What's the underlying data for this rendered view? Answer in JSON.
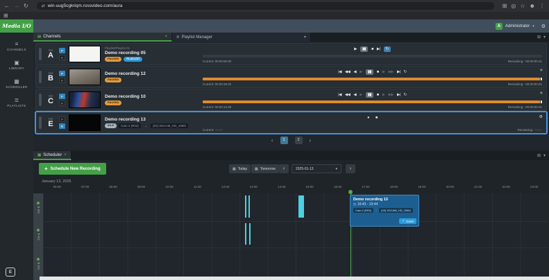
{
  "colors": {
    "brand_green": "#43a047",
    "accent_blue": "#2d9cdb",
    "paused_orange": "#e09a3e",
    "progress_orange": "#e08a2e",
    "selected_blue": "#4a90d9",
    "event_blue": "#1d5e91",
    "marker_cyan": "#4dd0e1",
    "now_green": "#4caf50"
  },
  "icons": {
    "back": "←",
    "forward": "→",
    "reload": "↻",
    "swap": "⇄",
    "extensions": "⊞",
    "search": "◎",
    "star": "☆",
    "avatar": "☻",
    "menu": "⋮",
    "apps": "⊞",
    "caret": "▾",
    "gear": "⚙",
    "grid": "▤",
    "list": "≣",
    "calendar": "▦",
    "close": "×",
    "play": "▶",
    "pause": "▮▮",
    "stop": "■",
    "record": "●",
    "prev": "|◀",
    "next": "▶|",
    "rewind": "◀◀",
    "fastforward": "▶▶",
    "stepback": "◀",
    "stepforward": "▶",
    "loop": "↻",
    "plus": "+",
    "check": "✓",
    "chevron_left": "‹",
    "chevron_right": "›",
    "arrow_right": "→",
    "clock": "◷",
    "panel": "▣",
    "nav_channels": "≡",
    "nav_library": "▣",
    "nav_scheduler": "▦",
    "nav_playlists": "≣",
    "logo_mark": "E"
  },
  "browser": {
    "url": "win-uug5cgkriqm.rossvideo.com/aura"
  },
  "header": {
    "logo": "Media I/O",
    "user": "Administrator",
    "user_initial": "A"
  },
  "sidebar": {
    "items": [
      {
        "label": "CHANNELS"
      },
      {
        "label": "LIBRARY"
      },
      {
        "label": "SCHEDULER"
      },
      {
        "label": "PLAYLISTS"
      }
    ]
  },
  "channels_panel": {
    "tabs": [
      {
        "label": "Channels"
      },
      {
        "label": "Playlist Manager"
      }
    ],
    "pr": [
      "P",
      "R"
    ],
    "rows": [
      {
        "ch": "CH",
        "letter": "A",
        "subtitle": "Playlist/Playlist 01",
        "title": "Demo recording 05",
        "badges": [
          "PAUSED",
          "PLAYLIST"
        ],
        "current": "Current: 00:00:00.00",
        "remaining": "Remaining: -00:00:00.01"
      },
      {
        "ch": "CH",
        "letter": "B",
        "title": "Demo recording 12",
        "badges": [
          "PAUSED"
        ],
        "current": "Current: 00:00:38.02",
        "remaining": "Remaining: -00:00:00.01"
      },
      {
        "ch": "CH",
        "letter": "C",
        "title": "Demo recording 10",
        "badges": [
          "PAUSED"
        ],
        "current": "Current: 00:00:13.06",
        "remaining": "Remaining: -00:00:00.01"
      },
      {
        "ch": "CH",
        "letter": "E",
        "title": "Demo recording 13",
        "badges": [
          "IDLE"
        ],
        "source_from": "Cam 2 (R03)",
        "source_to": "[02] XDCAM_HD_1080i",
        "current": "Current: --:--:--",
        "remaining": "Remaining: --:--:--"
      }
    ],
    "pagination": {
      "pages": [
        "1",
        "2"
      ]
    }
  },
  "scheduler": {
    "tab": "Scheduler",
    "new_recording": "Schedule New Recording",
    "today": "Today",
    "tomorrow": "Tomorrow",
    "date_value": "2025-01-13",
    "date_label": "January 13, 2025",
    "hours": [
      "06:00",
      "07:00",
      "08:00",
      "09:00",
      "10:00",
      "11:00",
      "12:00",
      "13:00",
      "14:00",
      "15:00",
      "16:00",
      "17:00",
      "18:00",
      "19:00",
      "20:00",
      "21:00",
      "22:00",
      "23:00"
    ],
    "rows": [
      {
        "label": "CH E"
      },
      {
        "label": "CH A"
      },
      {
        "label": "CH B"
      }
    ],
    "event": {
      "title": "Demo recording 13",
      "time": "16:43 - 19:44",
      "source_from": "Cam 2 (R03)",
      "source_to": "[02] XDCAM_HD_1080i",
      "done": "Done"
    }
  }
}
